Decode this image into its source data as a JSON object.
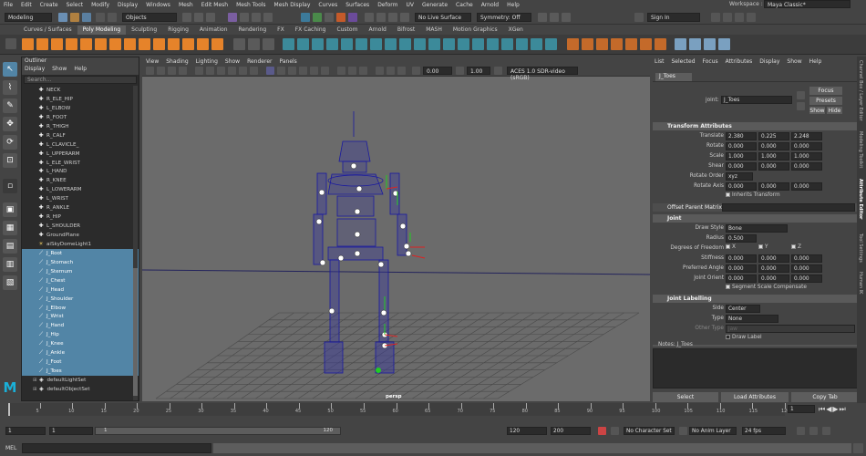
{
  "menubar": {
    "items": [
      "File",
      "Edit",
      "Create",
      "Select",
      "Modify",
      "Display",
      "Windows",
      "Mesh",
      "Edit Mesh",
      "Mesh Tools",
      "Mesh Display",
      "Curves",
      "Surfaces",
      "Deform",
      "UV",
      "Generate",
      "Cache",
      "Arnold",
      "Help"
    ],
    "workspace_label": "Workspace :",
    "workspace_value": "Maya Classic*"
  },
  "status": {
    "mode": "Modeling",
    "objects": "Objects",
    "live_surface": "No Live Surface",
    "symmetry": "Symmetry: Off",
    "sign_in": "Sign In"
  },
  "shelf_tabs": [
    "Curves / Surfaces",
    "Poly Modeling",
    "Sculpting",
    "Rigging",
    "Animation",
    "Rendering",
    "FX",
    "FX Caching",
    "Custom",
    "Arnold",
    "Bifrost",
    "MASH",
    "Motion Graphics",
    "XGen"
  ],
  "outliner": {
    "title": "Outliner",
    "menu": [
      "Display",
      "Show",
      "Help"
    ],
    "search_placeholder": "Search...",
    "items": [
      {
        "label": "NECK",
        "selected": false,
        "icon": "joint"
      },
      {
        "label": "R_ELE_HIP",
        "selected": false,
        "icon": "joint"
      },
      {
        "label": "L_ELBOW",
        "selected": false,
        "icon": "joint"
      },
      {
        "label": "R_FOOT",
        "selected": false,
        "icon": "joint"
      },
      {
        "label": "R_THIGH",
        "selected": false,
        "icon": "joint"
      },
      {
        "label": "R_CALF",
        "selected": false,
        "icon": "joint"
      },
      {
        "label": "L_CLAVICLE_",
        "selected": false,
        "icon": "joint"
      },
      {
        "label": "L_UPPERARM",
        "selected": false,
        "icon": "joint"
      },
      {
        "label": "L_ELE_WRIST",
        "selected": false,
        "icon": "joint"
      },
      {
        "label": "L_HAND",
        "selected": false,
        "icon": "joint"
      },
      {
        "label": "R_KNEE",
        "selected": false,
        "icon": "joint"
      },
      {
        "label": "L_LOWERARM",
        "selected": false,
        "icon": "joint"
      },
      {
        "label": "L_WRIST",
        "selected": false,
        "icon": "joint"
      },
      {
        "label": "R_ANKLE",
        "selected": false,
        "icon": "joint"
      },
      {
        "label": "R_HIP",
        "selected": false,
        "icon": "joint"
      },
      {
        "label": "L_SHOULDER",
        "selected": false,
        "icon": "joint"
      },
      {
        "label": "GroundPlane",
        "selected": false,
        "icon": "joint"
      },
      {
        "label": "aiSkyDomeLight1",
        "selected": false,
        "icon": "light"
      },
      {
        "label": "J_Root",
        "selected": true,
        "icon": "bone"
      },
      {
        "label": "J_Stomach",
        "selected": true,
        "icon": "bone"
      },
      {
        "label": "J_Sternum",
        "selected": true,
        "icon": "bone"
      },
      {
        "label": "J_Chest",
        "selected": true,
        "icon": "bone"
      },
      {
        "label": "J_Head",
        "selected": true,
        "icon": "bone"
      },
      {
        "label": "J_Shoulder",
        "selected": true,
        "icon": "bone"
      },
      {
        "label": "J_Elbow",
        "selected": true,
        "icon": "bone"
      },
      {
        "label": "J_Wrist",
        "selected": true,
        "icon": "bone"
      },
      {
        "label": "J_Hand",
        "selected": true,
        "icon": "bone"
      },
      {
        "label": "J_Hip",
        "selected": true,
        "icon": "bone"
      },
      {
        "label": "J_Knee",
        "selected": true,
        "icon": "bone"
      },
      {
        "label": "J_Ankle",
        "selected": true,
        "icon": "bone"
      },
      {
        "label": "J_Foot",
        "selected": true,
        "icon": "bone"
      },
      {
        "label": "J_Toes",
        "selected": true,
        "icon": "bone"
      },
      {
        "label": "defaultLightSet",
        "selected": false,
        "icon": "set"
      },
      {
        "label": "defaultObjectSet",
        "selected": false,
        "icon": "set"
      }
    ]
  },
  "viewport": {
    "menu": [
      "View",
      "Shading",
      "Lighting",
      "Show",
      "Renderer",
      "Panels"
    ],
    "exposure": "0.00",
    "gamma": "1.00",
    "color_space": "ACES 1.0 SDR-video (sRGB)",
    "camera_label": "persp"
  },
  "attribute_editor": {
    "menu": [
      "List",
      "Selected",
      "Focus",
      "Attributes",
      "Display",
      "Show",
      "Help"
    ],
    "node_tab": "J_Toes",
    "joint_label": "joint:",
    "joint_name": "J_Toes",
    "focus": "Focus",
    "presets": "Presets",
    "show": "Show",
    "hide": "Hide",
    "sections": {
      "transform": "Transform Attributes",
      "offset": "Offset Parent Matrix",
      "joint": "Joint",
      "labelling": "Joint Labelling"
    },
    "translate": {
      "label": "Translate",
      "values": [
        "2.380",
        "0.225",
        "2.248"
      ]
    },
    "rotate": {
      "label": "Rotate",
      "values": [
        "0.000",
        "0.000",
        "0.000"
      ]
    },
    "scale": {
      "label": "Scale",
      "values": [
        "1.000",
        "1.000",
        "1.000"
      ]
    },
    "shear": {
      "label": "Shear",
      "values": [
        "0.000",
        "0.000",
        "0.000"
      ]
    },
    "rotate_order": {
      "label": "Rotate Order",
      "value": "xyz"
    },
    "rotate_axis": {
      "label": "Rotate Axis",
      "values": [
        "0.000",
        "0.000",
        "0.000"
      ]
    },
    "inherits": "Inherits Transform",
    "draw_style": {
      "label": "Draw Style",
      "value": "Bone"
    },
    "radius": {
      "label": "Radius",
      "value": "0.500"
    },
    "dof": {
      "label": "Degrees of Freedom",
      "x": "X",
      "y": "Y",
      "z": "Z"
    },
    "stiffness": {
      "label": "Stiffness",
      "values": [
        "0.000",
        "0.000",
        "0.000"
      ]
    },
    "pref_angle": {
      "label": "Preferred Angle",
      "values": [
        "0.000",
        "0.000",
        "0.000"
      ]
    },
    "joint_orient": {
      "label": "Joint Orient",
      "values": [
        "0.000",
        "0.000",
        "0.000"
      ]
    },
    "segment_scale": "Segment Scale Compensate",
    "side": {
      "label": "Side",
      "value": "Center"
    },
    "type": {
      "label": "Type",
      "value": "None"
    },
    "other_type": {
      "label": "Other Type",
      "value": "jaw"
    },
    "draw_label": "Draw Label",
    "notes": "Notes:  J_Toes",
    "buttons": {
      "select": "Select",
      "load": "Load Attributes",
      "copy": "Copy Tab"
    }
  },
  "side_tabs": [
    "Channel Box / Layer Editor",
    "Modeling Toolkit",
    "Attribute Editor",
    "Tool Settings",
    "Human IK"
  ],
  "timeline": {
    "ticks": [
      "5",
      "10",
      "15",
      "20",
      "25",
      "30",
      "35",
      "40",
      "45",
      "50",
      "55",
      "60",
      "65",
      "70",
      "75",
      "80",
      "85",
      "90",
      "95",
      "100",
      "105",
      "110",
      "115",
      "120"
    ],
    "current_frame": "1"
  },
  "range": {
    "start": "1",
    "start2": "1",
    "range_start": "1",
    "range_end": "120",
    "end1": "120",
    "end2": "200",
    "character_set": "No Character Set",
    "anim_layer": "No Anim Layer",
    "fps": "24 fps"
  },
  "mel": {
    "label": "MEL"
  }
}
